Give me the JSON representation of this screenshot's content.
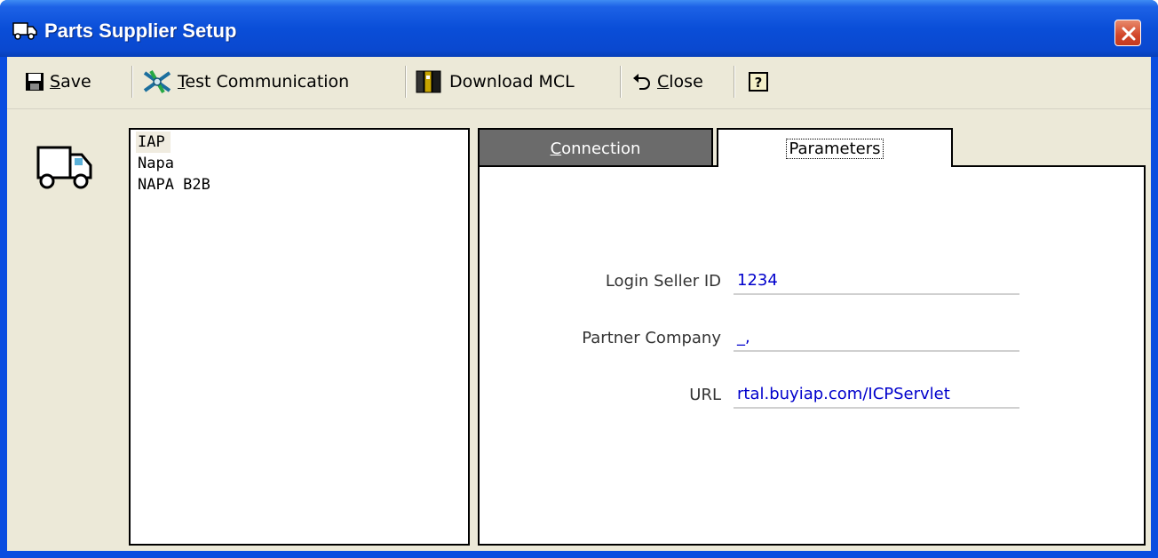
{
  "window": {
    "title": "Parts Supplier Setup",
    "icon": "truck-icon",
    "close_icon": "close-icon"
  },
  "toolbar": {
    "save": {
      "accel": "S",
      "rest": "ave",
      "icon": "floppy-disk-icon"
    },
    "test": {
      "accel": "T",
      "rest": "est Communication",
      "icon": "satellite-icon"
    },
    "download": {
      "label": "Download MCL",
      "icon": "book-download-icon"
    },
    "close": {
      "accel": "C",
      "rest": "lose",
      "icon": "undo-arrow-icon"
    },
    "help": {
      "icon": "help-icon"
    }
  },
  "suppliers": {
    "items": [
      "IAP",
      "Napa",
      "NAPA B2B"
    ],
    "selected": "IAP"
  },
  "tabs": {
    "connection": {
      "accel": "C",
      "rest": "onnection"
    },
    "parameters": {
      "label": "Parameters"
    },
    "active": "Parameters"
  },
  "parameters": {
    "login_seller_id": {
      "label": "Login Seller ID",
      "value": "1234"
    },
    "partner_company": {
      "label": "Partner Company",
      "value": "_,"
    },
    "url": {
      "label": "URL",
      "value": "rtal.buyiap.com/ICPServlet"
    }
  },
  "colors": {
    "titlebar": "#0a4ed8",
    "face": "#ece9d8",
    "value_text": "#0000cc",
    "inactive_tab": "#6b6b6b"
  }
}
